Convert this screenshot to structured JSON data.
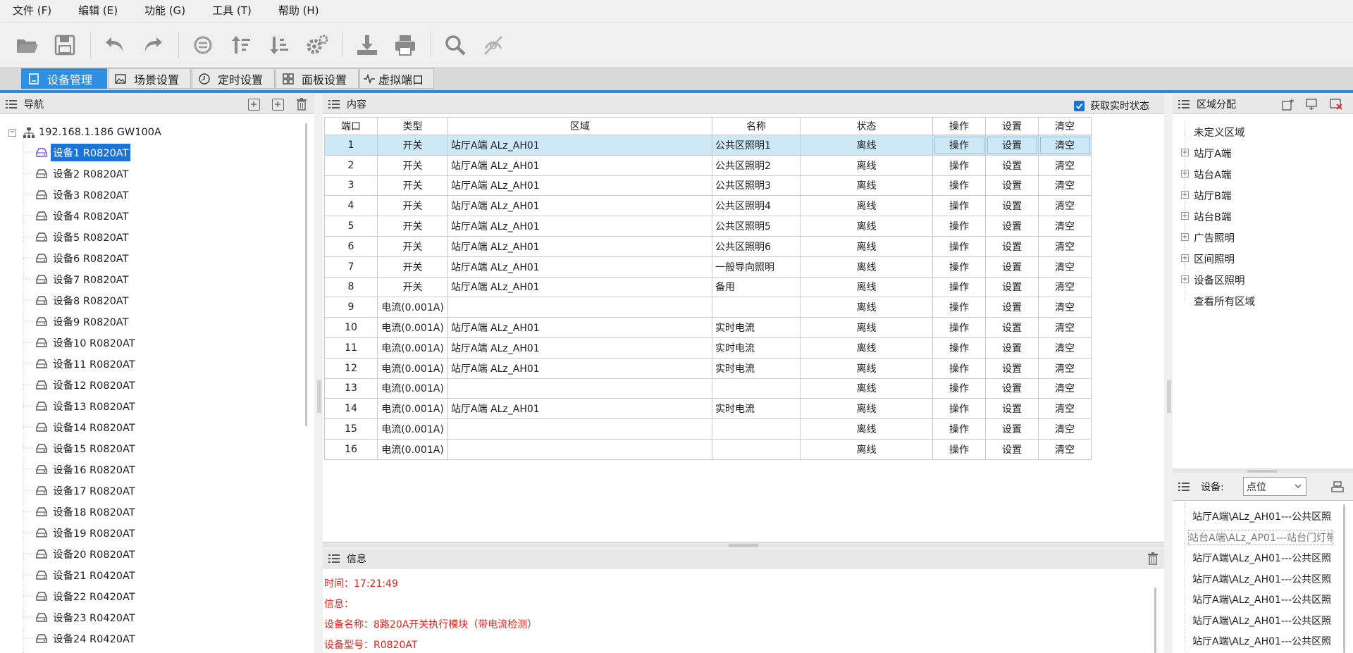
{
  "menu": [
    "文件 (F)",
    "编辑 (E)",
    "功能 (G)",
    "工具 (T)",
    "帮助 (H)"
  ],
  "toolbar_icons": [
    "folder-open-icon",
    "save-icon",
    "undo-icon",
    "redo-icon",
    "refresh-icon",
    "sort-ascending-icon",
    "sort-descending-icon",
    "settings-gear-icon",
    "download-icon",
    "printer-icon",
    "search-icon",
    "disable-icon"
  ],
  "tabs": [
    "设备管理",
    "场景设置",
    "定时设置",
    "面板设置",
    "虚拟端口"
  ],
  "nav": {
    "title": "导航",
    "root": "192.168.1.186 GW100A",
    "devices": [
      "设备1 R0820AT",
      "设备2 R0820AT",
      "设备3 R0820AT",
      "设备4 R0820AT",
      "设备5 R0820AT",
      "设备6 R0820AT",
      "设备7 R0820AT",
      "设备8 R0820AT",
      "设备9 R0820AT",
      "设备10 R0820AT",
      "设备11 R0820AT",
      "设备12 R0820AT",
      "设备13 R0820AT",
      "设备14 R0820AT",
      "设备15 R0820AT",
      "设备16 R0820AT",
      "设备17 R0820AT",
      "设备18 R0820AT",
      "设备19 R0820AT",
      "设备20 R0820AT",
      "设备21 R0420AT",
      "设备22 R0420AT",
      "设备23 R0420AT",
      "设备24 R0420AT"
    ]
  },
  "content": {
    "title": "内容",
    "realtime_label": "获取实时状态",
    "realtime_checked": true,
    "columns": [
      "端口",
      "类型",
      "区域",
      "名称",
      "状态",
      "操作",
      "设置",
      "清空"
    ],
    "rows": [
      [
        "1",
        "开关",
        "站厅A端 ALz_AH01",
        "公共区照明1",
        "离线",
        "操作",
        "设置",
        "清空"
      ],
      [
        "2",
        "开关",
        "站厅A端 ALz_AH01",
        "公共区照明2",
        "离线",
        "操作",
        "设置",
        "清空"
      ],
      [
        "3",
        "开关",
        "站厅A端 ALz_AH01",
        "公共区照明3",
        "离线",
        "操作",
        "设置",
        "清空"
      ],
      [
        "4",
        "开关",
        "站厅A端 ALz_AH01",
        "公共区照明4",
        "离线",
        "操作",
        "设置",
        "清空"
      ],
      [
        "5",
        "开关",
        "站厅A端 ALz_AH01",
        "公共区照明5",
        "离线",
        "操作",
        "设置",
        "清空"
      ],
      [
        "6",
        "开关",
        "站厅A端 ALz_AH01",
        "公共区照明6",
        "离线",
        "操作",
        "设置",
        "清空"
      ],
      [
        "7",
        "开关",
        "站厅A端 ALz_AH01",
        "一般导向照明",
        "离线",
        "操作",
        "设置",
        "清空"
      ],
      [
        "8",
        "开关",
        "站厅A端 ALz_AH01",
        "备用",
        "离线",
        "操作",
        "设置",
        "清空"
      ],
      [
        "9",
        "电流(0.001A)",
        "",
        "",
        "离线",
        "操作",
        "设置",
        "清空"
      ],
      [
        "10",
        "电流(0.001A)",
        "站厅A端 ALz_AH01",
        "实时电流",
        "离线",
        "操作",
        "设置",
        "清空"
      ],
      [
        "11",
        "电流(0.001A)",
        "站厅A端 ALz_AH01",
        "实时电流",
        "离线",
        "操作",
        "设置",
        "清空"
      ],
      [
        "12",
        "电流(0.001A)",
        "站厅A端 ALz_AH01",
        "实时电流",
        "离线",
        "操作",
        "设置",
        "清空"
      ],
      [
        "13",
        "电流(0.001A)",
        "",
        "",
        "离线",
        "操作",
        "设置",
        "清空"
      ],
      [
        "14",
        "电流(0.001A)",
        "站厅A端 ALz_AH01",
        "实时电流",
        "离线",
        "操作",
        "设置",
        "清空"
      ],
      [
        "15",
        "电流(0.001A)",
        "",
        "",
        "离线",
        "操作",
        "设置",
        "清空"
      ],
      [
        "16",
        "电流(0.001A)",
        "",
        "",
        "离线",
        "操作",
        "设置",
        "清空"
      ]
    ]
  },
  "info": {
    "title": "信息",
    "lines": [
      "时间：17:21:49",
      "信息：",
      "设备名称：8路20A开关执行模块（带电流检测）",
      "设备型号：R0820AT"
    ]
  },
  "region": {
    "title": "区域分配",
    "items": [
      "未定义区域",
      "站厅A端",
      "站台A端",
      "站厅B端",
      "站台B端",
      "广告照明",
      "区间照明",
      "设备区照明",
      "查看所有区域"
    ]
  },
  "device_panel": {
    "label": "设备:",
    "select_value": "点位",
    "items": [
      "站厅A端\\ALz_AH01---公共区照",
      "站台A端\\ALz_AP01---站台门灯带",
      "站厅A端\\ALz_AH01---公共区照",
      "站厅A端\\ALz_AH01---公共区照",
      "站厅A端\\ALz_AH01---公共区照",
      "站厅A端\\ALz_AH01---公共区照",
      "站厅A端\\ALz_AH01---公共区照"
    ]
  },
  "colors": {
    "accent": "#2e8fe0",
    "selection": "#1a73d8",
    "row_selected": "#cde8f6",
    "info_text": "#e0211b"
  }
}
